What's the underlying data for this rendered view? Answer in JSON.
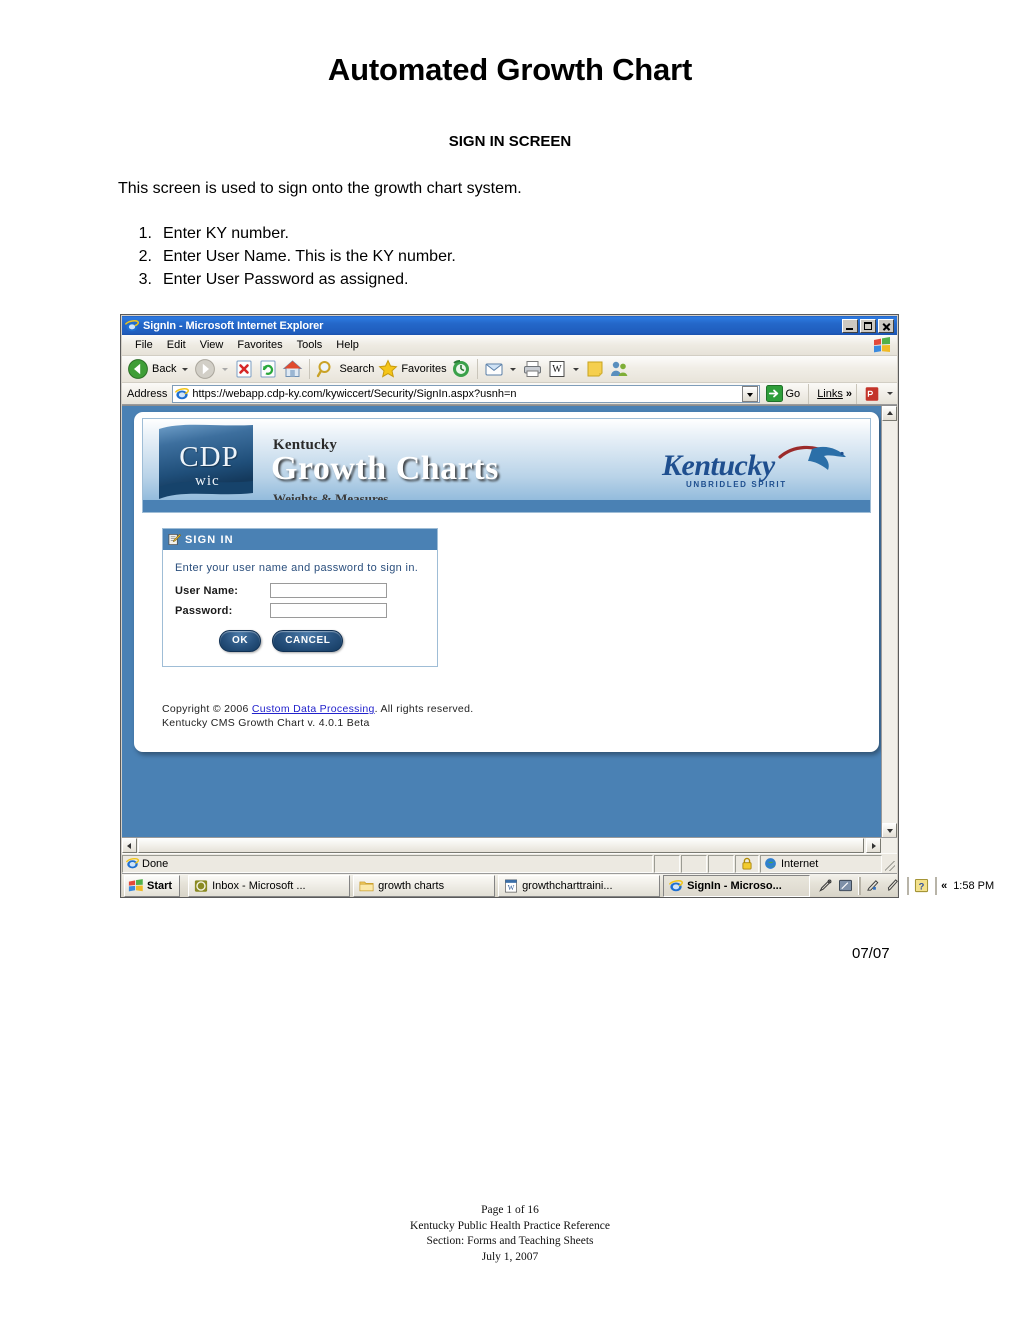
{
  "document": {
    "title": "Automated Growth Chart",
    "subtitle": "SIGN IN SCREEN",
    "intro": "This screen is used to sign onto the growth chart system.",
    "steps": [
      {
        "num": "1.",
        "text": "Enter KY number."
      },
      {
        "num": "2.",
        "text": "Enter User Name. This is the KY number."
      },
      {
        "num": "3.",
        "text": "Enter User Password as assigned."
      }
    ],
    "revision_date": "07/07",
    "footer": {
      "page": "Page 1 of 16",
      "reference": "Kentucky Public Health Practice Reference",
      "section": "Section: Forms and Teaching Sheets",
      "date": "July 1, 2007"
    }
  },
  "browser": {
    "window_title": "SignIn - Microsoft Internet Explorer",
    "window_buttons": {
      "minimize": "Minimize",
      "maximize": "Maximize",
      "close": "Close"
    },
    "menu": [
      "File",
      "Edit",
      "View",
      "Favorites",
      "Tools",
      "Help"
    ],
    "toolbar": {
      "back": "Back",
      "forward": "",
      "stop": "",
      "refresh": "",
      "home": "",
      "search": "Search",
      "favorites": "Favorites",
      "history": "",
      "mail": "",
      "print": "",
      "edit_word": "",
      "notes": "",
      "messenger": ""
    },
    "address": {
      "label": "Address",
      "url": "https://webapp.cdp-ky.com/kywiccert/Security/SignIn.aspx?usnh=n",
      "go": "Go",
      "links": "Links",
      "overflow": "»"
    },
    "status": {
      "text": "Done",
      "zone": "Internet"
    }
  },
  "page": {
    "banner": {
      "logo_text": "CDP",
      "logo_sub": "wic",
      "pretitle": "Kentucky",
      "title": "Growth Charts",
      "subtitle": "Weights & Measures",
      "state_logo": "Kentucky",
      "state_tagline": "UNBRIDLED SPIRIT"
    },
    "signin": {
      "header": "SIGN IN",
      "prompt": "Enter your user name and password to sign in.",
      "fields": [
        {
          "label": "User Name:",
          "value": "",
          "placeholder": ""
        },
        {
          "label": "Password:",
          "value": "",
          "placeholder": ""
        }
      ],
      "ok_label": "OK",
      "cancel_label": "CANCEL"
    },
    "copyright": {
      "prefix": "Copyright © 2006 ",
      "link": "Custom Data Processing",
      "suffix": ". All rights reserved.",
      "version": "Kentucky CMS Growth Chart v. 4.0.1 Beta"
    }
  },
  "taskbar": {
    "start": "Start",
    "items": [
      {
        "label": "Inbox - Microsoft ...",
        "icon": "outlook-icon",
        "active": false
      },
      {
        "label": "growth charts",
        "icon": "folder-icon",
        "active": false
      },
      {
        "label": "growthcharttraini...",
        "icon": "word-icon",
        "active": false
      },
      {
        "label": "SignIn - Microso...",
        "icon": "ie-icon",
        "active": true
      }
    ],
    "clock": "1:58 PM",
    "tray_chevron": "«"
  },
  "colors": {
    "title_bar_blue": "#2467c9",
    "page_blue": "#4a81b4",
    "panel_header_blue": "#4a81b4",
    "link_blue": "#2222cc",
    "button_navy": "#27517d"
  }
}
